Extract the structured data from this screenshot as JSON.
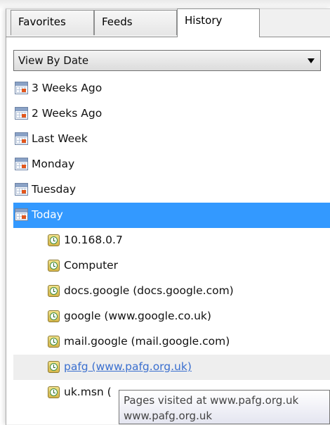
{
  "tabs": [
    {
      "label": "Favorites",
      "active": false
    },
    {
      "label": "Feeds",
      "active": false
    },
    {
      "label": "History",
      "active": true
    }
  ],
  "view_dropdown": {
    "selected": "View By Date"
  },
  "history": {
    "dates": [
      "3 Weeks Ago",
      "2 Weeks Ago",
      "Last Week",
      "Monday",
      "Tuesday",
      "Today"
    ],
    "selected_date": "Today",
    "sites": [
      "10.168.0.7",
      "Computer",
      "docs.google (docs.google.com)",
      "google (www.google.co.uk)",
      "mail.google (mail.google.com)",
      "pafg (www.pafg.org.uk)",
      "uk.msn ("
    ],
    "hovered_site": "pafg (www.pafg.org.uk)"
  },
  "tooltip": {
    "line1": "Pages visited at www.pafg.org.uk",
    "line2": "www.pafg.org.uk"
  },
  "icons": {
    "date_group": "calendar-icon",
    "site": "history-clock-icon"
  }
}
